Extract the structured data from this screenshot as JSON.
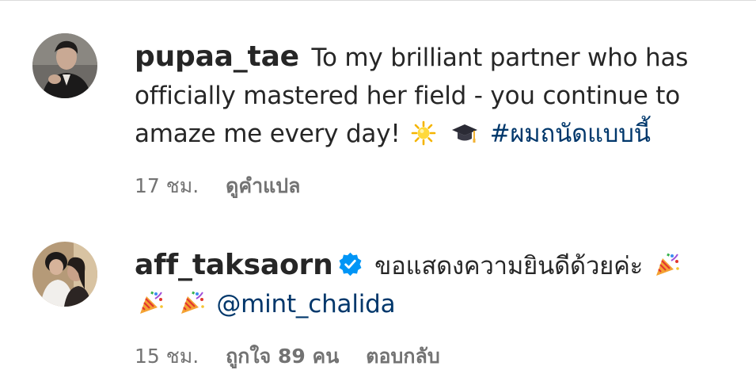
{
  "comments": [
    {
      "username": "pupaa_tae",
      "verified": false,
      "text": "To my brilliant partner who has officially mastered her field - you continue to amaze me every day!",
      "emojis": [
        "sun-emoji",
        "graduation-cap-emoji"
      ],
      "hashtag": "#ผมถนัดแบบนี้",
      "time": "17 ชม.",
      "actions": [
        "ดูคำแปล"
      ]
    },
    {
      "username": "aff_taksaorn",
      "verified": true,
      "text": "ขอแสดงความยินดีด้วยค่ะ",
      "emojis": [
        "party-popper-emoji",
        "party-popper-emoji",
        "party-popper-emoji"
      ],
      "mention": "@mint_chalida",
      "time": "15 ชม.",
      "actions": [
        "ถูกใจ 89 คน",
        "ตอบกลับ"
      ]
    }
  ],
  "colors": {
    "text": "#262626",
    "meta": "#737373",
    "link": "#00376b",
    "verified": "#0095f6"
  }
}
